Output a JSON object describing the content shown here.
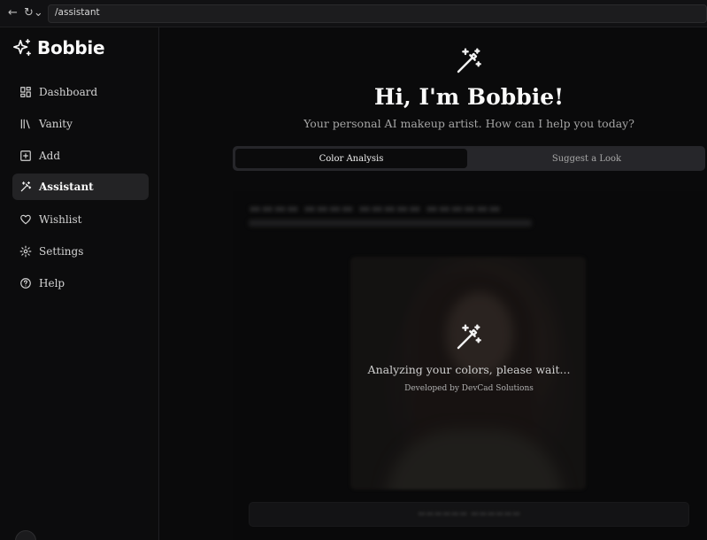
{
  "browser": {
    "back_icon": "arrow-left-icon",
    "reload_icon": "reload-icon",
    "url": "/assistant"
  },
  "sidebar": {
    "brand": "Bobbie",
    "brand_icon": "sparkles-icon",
    "items": [
      {
        "label": "Dashboard",
        "icon": "dashboard-icon",
        "active": false
      },
      {
        "label": "Vanity",
        "icon": "library-icon",
        "active": false
      },
      {
        "label": "Add",
        "icon": "plus-square-icon",
        "active": false
      },
      {
        "label": "Assistant",
        "icon": "magic-wand-icon",
        "active": true
      },
      {
        "label": "Wishlist",
        "icon": "heart-icon",
        "active": false
      },
      {
        "label": "Settings",
        "icon": "gear-icon",
        "active": false
      },
      {
        "label": "Help",
        "icon": "help-circle-icon",
        "active": false
      }
    ]
  },
  "main": {
    "hero_icon": "magic-wand-icon",
    "greeting": "Hi, I'm Bobbie!",
    "subtitle": "Your personal AI makeup artist. How can I help you today?",
    "tabs": [
      {
        "label": "Color Analysis",
        "selected": true
      },
      {
        "label": "Suggest a Look",
        "selected": false
      }
    ],
    "loading": {
      "icon": "magic-wand-icon",
      "message": "Analyzing your colors, please wait...",
      "credit": "Developed by DevCad Solutions"
    }
  },
  "colors": {
    "background": "#0a0a0b",
    "sidebar_active": "#232325",
    "text_primary": "#fafafa",
    "text_muted": "#a5a5a5"
  }
}
